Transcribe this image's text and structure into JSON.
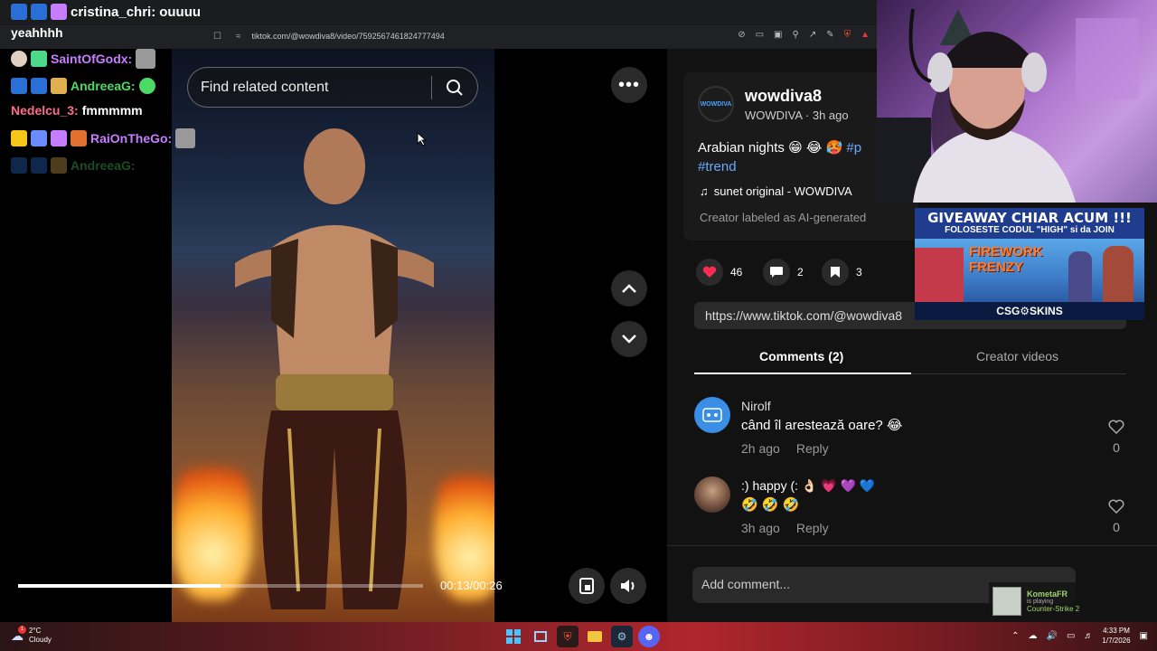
{
  "browser": {
    "url": "tiktok.com/@wowdiva8/video/7592567461824777494"
  },
  "chat": {
    "messages": [
      {
        "user": "cristina_chri:",
        "text": "ouuuu",
        "color": "#ffffff"
      },
      {
        "user": "",
        "text": "yeahhhh",
        "color": "#ffffff"
      },
      {
        "user": "SaintOfGodx:",
        "text": "",
        "color": "#c77dff"
      },
      {
        "user": "AndreeaG:",
        "text": "",
        "color": "#4cd964"
      },
      {
        "user": "Nedelcu_3:",
        "text": "fmmmmm",
        "color": "#ff6b8a"
      },
      {
        "user": "RaiOnTheGo:",
        "text": "",
        "color": "#c77dff"
      },
      {
        "user": "AndreeaG:",
        "text": "",
        "color": "#2e6b3a"
      }
    ]
  },
  "video": {
    "search_placeholder": "Find related content",
    "time": "00:13/00:26",
    "progress": 0.5
  },
  "post": {
    "username": "wowdiva8",
    "avatar_text": "WOWDIVA",
    "display_and_time": "WOWDIVA · 3h ago",
    "caption": "Arabian nights 😁 😂 🥵 ",
    "caption_tag_partial": "#p",
    "hashtag": "#trend",
    "sound": "sunet original - WOWDIVA",
    "ai_label": "Creator labeled as AI-generated",
    "likes": "46",
    "comments_count": "2",
    "saves": "3",
    "link": "https://www.tiktok.com/@wowdiva8"
  },
  "tabs": {
    "comments": "Comments (2)",
    "creator": "Creator videos"
  },
  "comments": [
    {
      "name": "Nirolf",
      "text": "când îl arestează oare? 😂",
      "time": "2h ago",
      "reply": "Reply",
      "likes": "0"
    },
    {
      "name": ":) happy (: 👌🏻 💗 💜 💙",
      "text": "🤣 🤣 🤣",
      "time": "3h ago",
      "reply": "Reply",
      "likes": "0"
    }
  ],
  "add_comment_placeholder": "Add comment...",
  "ad": {
    "title": "GIVEAWAY CHIAR ACUM !!!",
    "subtitle": "FOLOSESTE CODUL \"HIGH\" si da JOIN",
    "game": "FIREWORK FRENZY",
    "brand": "CSG⚙SKINS"
  },
  "notification": {
    "user": "KometaFR",
    "status": "is playing",
    "game": "Counter-Strike 2"
  },
  "taskbar": {
    "temperature": "2°C",
    "condition": "Cloudy",
    "time": "4:33 PM",
    "date": "1/7/2026",
    "weather_badge": "1"
  }
}
